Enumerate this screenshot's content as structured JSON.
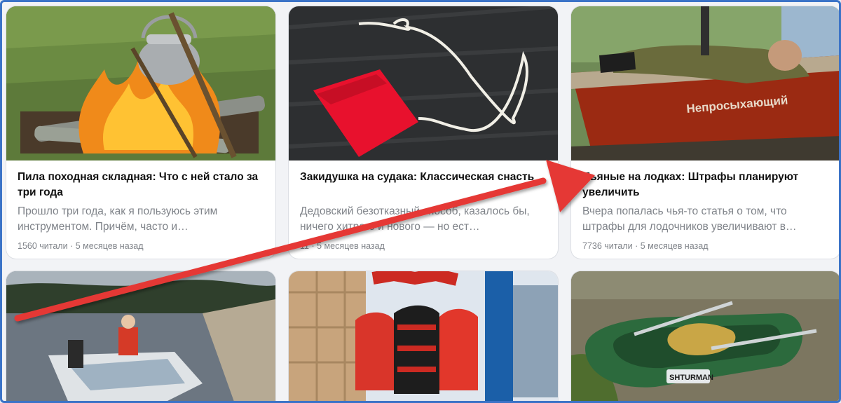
{
  "cards": [
    {
      "title": "Пила походная складная: Что с ней стало за три года",
      "desc": "Прошло три года, как я пользуюсь этим инструментом. Причём, часто и…",
      "views": "1560 читали",
      "dot": "·",
      "age": "5 месяцев назад",
      "image": "campfire-kettle-image"
    },
    {
      "title": "Закидушка на судака: Классическая снасть",
      "desc": "Дедовский безотказный способ, казалось бы, ничего хитрого и нового — но ест…",
      "views": "11",
      "dot": "·",
      "age": "5 месяцев назад",
      "image": "red-cloth-cord-image"
    },
    {
      "title": "Пьяные на лодках: Штрафы планируют увеличить",
      "desc": "Вчера попалась чья-то статья о том, что штрафы для лодочников увеличивают в…",
      "views": "7736 читали",
      "dot": "·",
      "age": "5 месяцев назад",
      "image": "man-on-boat-image",
      "boat_text": "Непросыхающий"
    },
    {
      "image": "motorboat-river-image"
    },
    {
      "image": "life-jackets-store-image"
    },
    {
      "image": "inflatable-boat-image",
      "boat_brand": "SHTURMAN"
    }
  ],
  "colors": {
    "frame": "#3b73c7",
    "arrow": "#e53935",
    "muted": "#7f8389"
  }
}
